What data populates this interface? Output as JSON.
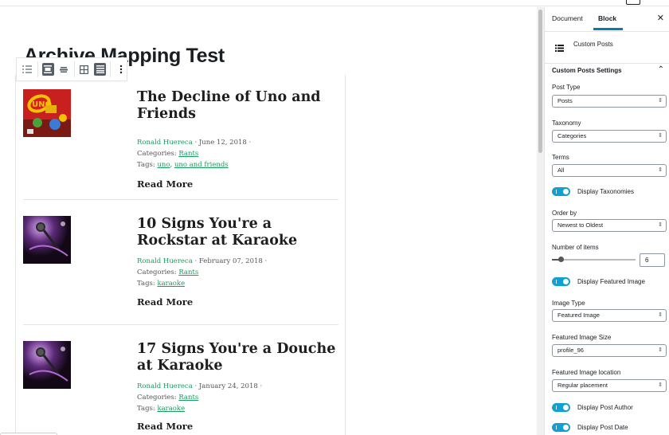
{
  "editor": {
    "page_title": "Archive Mapping Test",
    "posts": [
      {
        "title": "The Decline of Uno and Friends",
        "author": "Ronald Huereca",
        "date": " · June 12, 2018 ·",
        "categories_label": "Categories: ",
        "categories": "Rants",
        "tags_label": "Tags: ",
        "tags": [
          "uno",
          "uno and friends"
        ],
        "tags_sep": ", ",
        "read_more": "Read More",
        "image_alt": "uno"
      },
      {
        "title": "10 Signs You're a Rockstar at Karaoke",
        "author": "Ronald Huereca",
        "date": " · February 07, 2018 ·",
        "categories_label": "Categories: ",
        "categories": "Rants",
        "tags_label": "Tags: ",
        "tags": [
          "karaoke"
        ],
        "read_more": "Read More",
        "image_alt": "microphone"
      },
      {
        "title": "17 Signs You're a Douche at Karaoke",
        "author": "Ronald Huereca",
        "date": " · January 24, 2018 ·",
        "categories_label": "Categories: ",
        "categories": "Rants",
        "tags_label": "Tags: ",
        "tags": [
          "karaoke"
        ],
        "read_more": "Read More",
        "image_alt": "microphone"
      }
    ],
    "toolbar_icons": [
      "list-view-icon",
      "align-center-icon",
      "align-wide-icon",
      "grid-view-icon",
      "table-view-icon",
      "more-options-icon"
    ]
  },
  "sidebar": {
    "tabs": [
      "Document",
      "Block"
    ],
    "active_tab": "Block",
    "close_icon": "close-icon",
    "block_name": "Custom Posts",
    "block_icon": "list-icon",
    "panel_title": "Custom Posts Settings",
    "fields": {
      "post_type_label": "Post Type",
      "post_type_value": "Posts",
      "taxonomy_label": "Taxonomy",
      "taxonomy_value": "Categories",
      "terms_label": "Terms",
      "terms_value": "All",
      "display_taxonomies": "Display Taxonomies",
      "order_by_label": "Order by",
      "order_by_value": "Newest to Oldest",
      "num_items_label": "Number of items",
      "num_items_value": "6",
      "num_items_min": 1,
      "num_items_max": 50,
      "display_featured_image": "Display Featured Image",
      "image_type_label": "Image Type",
      "image_type_value": "Featured Image",
      "image_size_label": "Featured Image Size",
      "image_size_value": "profile_96",
      "image_location_label": "Featured Image location",
      "image_location_value": "Regular placement",
      "display_post_author": "Display Post Author",
      "display_post_date": "Display Post Date"
    },
    "toggle_color": "#11a0d2",
    "accent": "#007cba"
  },
  "colors": {
    "link_green": "#1c9a5e"
  }
}
